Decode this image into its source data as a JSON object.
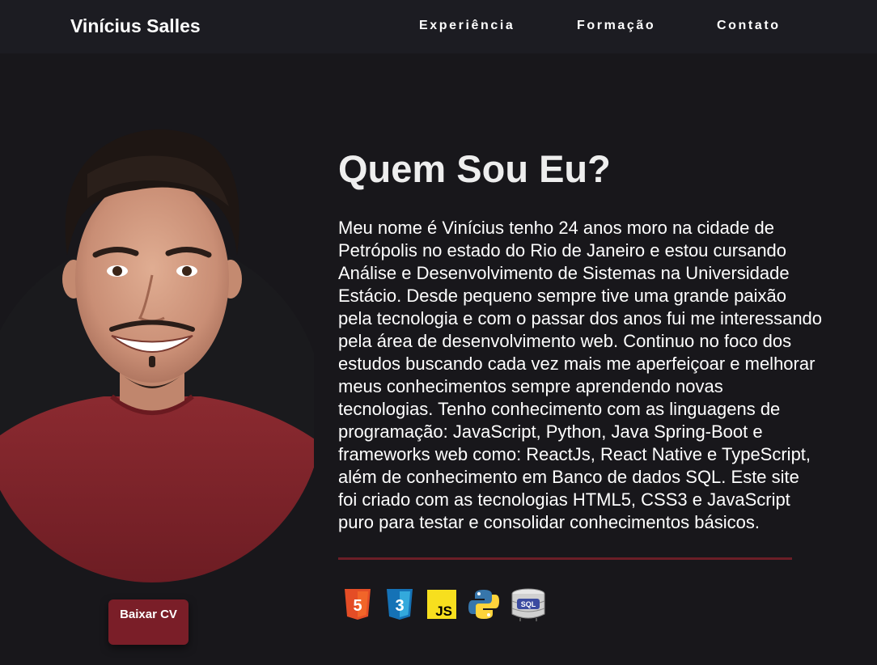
{
  "navbar": {
    "brand": "Vinícius Salles",
    "links": [
      "Experiência",
      "Formação",
      "Contato"
    ]
  },
  "about": {
    "title": "Quem Sou Eu?",
    "paragraph_lines": [
      "Meu nome é Vinícius tenho 24 anos moro na cidade de",
      "Petrópolis no estado do Rio de Janeiro e estou cursando",
      "Análise e Desenvolvimento de Sistemas na Universidade",
      "Estácio. Desde pequeno sempre tive uma grande paixão",
      "pela tecnologia e com o passar dos anos fui me interessando",
      "pela área de desenvolvimento web. Continuo no foco dos",
      "estudos buscando cada vez mais me aperfeiçoar e melhorar",
      "meus conhecimentos sempre aprendendo novas",
      "tecnologias. Tenho conhecimento com as linguagens de",
      "programação: JavaScript, Python, Java Spring-Boot e",
      "frameworks web como: ReactJs, React Native e TypeScript,",
      "além de conhecimento em Banco de dados SQL. Este site",
      "foi criado com as tecnologias HTML5, CSS3 e JavaScript",
      "puro para testar e consolidar conhecimentos básicos."
    ]
  },
  "profile": {
    "cv_button": "Baixar CV"
  },
  "tech_icons": [
    "html5-icon",
    "css3-icon",
    "javascript-icon",
    "python-icon",
    "sql-database-icon"
  ],
  "tech_icon_labels": {
    "html": "5",
    "css": "3",
    "js": "JS",
    "sql": "SQL"
  },
  "colors": {
    "background": "#18171b",
    "navbar": "#1c1c22",
    "accent": "#7a1e28",
    "html5": "#e44d26",
    "css3": "#1572b6",
    "js": "#f7df1e",
    "python_blue": "#3776ab",
    "python_yellow": "#ffd43b"
  }
}
